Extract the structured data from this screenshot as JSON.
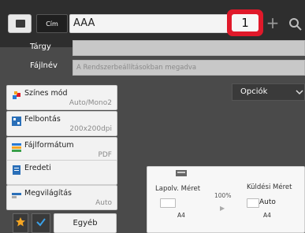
{
  "topbar": {
    "address_book_icon": "address-book-icon",
    "cim_label": "Cím",
    "destination": "AAA",
    "copies": "1",
    "plus": "+",
    "search_icon": "search-icon"
  },
  "fields": {
    "subject_label": "Tárgy",
    "subject_value": "",
    "filename_label": "Fájlnév",
    "filename_value": "A Rendszerbeállításokban megadva"
  },
  "settings": [
    {
      "name": "Színes mód",
      "value": "Auto/Mono2",
      "icon": "color-mode-icon"
    },
    {
      "name": "Felbontás",
      "value": "200x200dpi",
      "icon": "resolution-icon"
    },
    {
      "name": "Fájlformátum",
      "value": "PDF",
      "icon": "file-format-icon"
    },
    {
      "name": "Eredeti",
      "value": "",
      "icon": "original-icon"
    },
    {
      "name": "Megvilágítás",
      "value": "Auto",
      "icon": "exposure-icon"
    }
  ],
  "options": {
    "label": "Opciók"
  },
  "preview": {
    "scan_size_title": "Lapolv. Méret",
    "send_size_title": "Küldési Méret",
    "ratio": "100%",
    "scan_size": "A4",
    "send_auto": "Auto",
    "send_size": "A4"
  },
  "bottom": {
    "other_label": "Egyéb"
  },
  "colors": {
    "accent_red": "#e0192a",
    "background": "#4a4a4a",
    "star": "#f5a623",
    "check": "#3aa0e8"
  }
}
